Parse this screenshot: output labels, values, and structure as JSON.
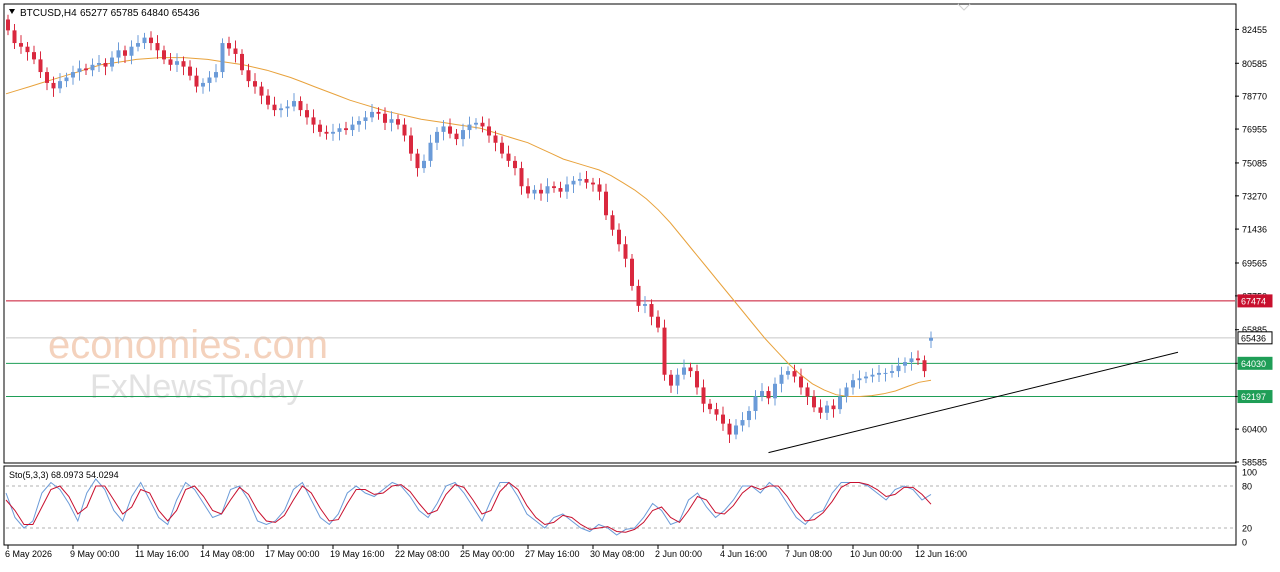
{
  "chart_data": {
    "type": "candlestick",
    "header": {
      "symbol": "BTCUSD,H4",
      "ohlc_text": "65277 65785 64840 65436",
      "dropdown_icon": "triangle-down-icon"
    },
    "price_axis": {
      "ylim": [
        58585,
        83800
      ],
      "ticks": [
        82455,
        80585,
        78770,
        76955,
        75085,
        73270,
        71436,
        69565,
        67750,
        65885,
        64030,
        62197,
        60400,
        58585
      ],
      "grid": false
    },
    "horizontal_levels": [
      {
        "value": 67474,
        "label": "67474",
        "color": "#c8102e"
      },
      {
        "value": 64030,
        "label": "64030",
        "color": "#1f9e57"
      },
      {
        "value": 62197,
        "label": "62197",
        "color": "#1f9e57"
      }
    ],
    "current_price": {
      "value": 65436,
      "label": "65436"
    },
    "trendline": {
      "from": [
        117,
        59100
      ],
      "to": [
        180,
        64640
      ],
      "color": "#000000"
    },
    "moving_average_color": "#e8a23c",
    "bull_color": "#6b9bd8",
    "bear_color": "#d9283e",
    "watermark": {
      "line1": "economies.com",
      "line2": "FxNewsToday"
    },
    "stochastic": {
      "label": "Sto(5,3,3) 68.0973 54.0294",
      "ylim": [
        0,
        100
      ],
      "ticks": [
        100,
        80,
        20,
        0
      ],
      "levels": [
        80,
        20
      ],
      "main_color": "#6b9bd8",
      "signal_color": "#c8102e"
    },
    "time_axis": {
      "labels": [
        "6 May 2026",
        "9 May 00:00",
        "11 May 16:00",
        "14 May 08:00",
        "17 May 00:00",
        "19 May 16:00",
        "22 May 08:00",
        "25 May 00:00",
        "27 May 16:00",
        "30 May 08:00",
        "2 Jun 00:00",
        "4 Jun 16:00",
        "7 Jun 08:00",
        "10 Jun 00:00",
        "12 Jun 16:00"
      ],
      "label_bar_index": [
        0,
        10,
        20,
        30,
        40,
        50,
        60,
        70,
        80,
        90,
        100,
        110,
        120,
        130,
        140
      ]
    },
    "closes": [
      82400,
      81700,
      81500,
      81200,
      80800,
      80100,
      79500,
      79200,
      79600,
      79800,
      80100,
      80300,
      80200,
      80500,
      80600,
      80400,
      80900,
      81300,
      81000,
      81500,
      81700,
      82000,
      81700,
      81300,
      80800,
      80500,
      80700,
      80400,
      79900,
      79300,
      79500,
      79800,
      80100,
      81700,
      81400,
      81100,
      80200,
      79600,
      79300,
      78800,
      78300,
      78000,
      78100,
      78200,
      78500,
      78000,
      77600,
      77200,
      76800,
      76700,
      76800,
      77000,
      76900,
      77200,
      77400,
      77600,
      77900,
      77800,
      77300,
      77500,
      77200,
      76600,
      75600,
      74800,
      75200,
      76200,
      76800,
      77100,
      76700,
      76400,
      76900,
      77200,
      77300,
      77100,
      76600,
      76200,
      75600,
      75200,
      74800,
      73800,
      73400,
      73600,
      73400,
      73800,
      73700,
      73500,
      73900,
      74100,
      74200,
      74000,
      73900,
      73500,
      72200,
      71400,
      70600,
      69800,
      68300,
      67200,
      67300,
      66600,
      66000,
      63400,
      62800,
      63400,
      63800,
      63600,
      62700,
      61800,
      61500,
      61200,
      60700,
      60100,
      60600,
      60900,
      61400,
      62200,
      62500,
      62100,
      62900,
      63400,
      63600,
      63300,
      62700,
      62200,
      61600,
      61300,
      61700,
      61500,
      62200,
      62700,
      63100,
      63200,
      63300,
      63400,
      63500,
      63500,
      63600,
      63900,
      64100,
      64300,
      64200,
      63600,
      65436
    ],
    "opens": [
      83000,
      82400,
      81700,
      81500,
      81200,
      80800,
      80100,
      79500,
      79200,
      79600,
      79800,
      80100,
      80300,
      80200,
      80500,
      80600,
      80400,
      80900,
      81300,
      81000,
      81500,
      81700,
      82000,
      81700,
      81300,
      80800,
      80500,
      80700,
      80400,
      79900,
      79300,
      79500,
      79800,
      80100,
      81700,
      81400,
      81100,
      80200,
      79600,
      79300,
      78800,
      78300,
      78000,
      78100,
      78200,
      78500,
      78000,
      77600,
      77200,
      76800,
      76700,
      76800,
      77000,
      76900,
      77200,
      77400,
      77600,
      77900,
      77800,
      77300,
      77500,
      77200,
      76600,
      75600,
      74800,
      75200,
      76200,
      76800,
      77100,
      76700,
      76400,
      76900,
      77200,
      77300,
      77100,
      76600,
      76200,
      75600,
      75200,
      74800,
      73800,
      73400,
      73600,
      73400,
      73800,
      73700,
      73500,
      73900,
      74100,
      74200,
      74000,
      73900,
      73500,
      72200,
      71400,
      70600,
      69800,
      68300,
      67200,
      67300,
      66600,
      66000,
      63400,
      62800,
      63400,
      63800,
      63600,
      62700,
      61800,
      61500,
      61200,
      60700,
      60100,
      60600,
      60900,
      61400,
      62200,
      62500,
      62100,
      62900,
      63400,
      63600,
      63300,
      62700,
      62200,
      61600,
      61300,
      61700,
      61500,
      62200,
      62700,
      63100,
      63200,
      63300,
      63400,
      63500,
      63500,
      63600,
      63900,
      64100,
      64300,
      64200,
      65277
    ],
    "ma": [
      78900,
      79100,
      79300,
      79500,
      79700,
      79900,
      80100,
      80300,
      80500,
      80600,
      80700,
      80800,
      80850,
      80900,
      80900,
      80900,
      80850,
      80800,
      80700,
      80600,
      80500,
      80350,
      80200,
      80000,
      79800,
      79550,
      79300,
      79050,
      78800,
      78550,
      78350,
      78150,
      77950,
      77800,
      77650,
      77500,
      77400,
      77300,
      77200,
      77100,
      77000,
      76800,
      76600,
      76400,
      76200,
      75900,
      75600,
      75300,
      75100,
      74900,
      74700,
      74400,
      74000,
      73600,
      73100,
      72500,
      71800,
      71000,
      70200,
      69400,
      68600,
      67800,
      67000,
      66200,
      65400,
      64700,
      64000,
      63400,
      62900,
      62550,
      62300,
      62200,
      62200,
      62250,
      62350,
      62500,
      62750,
      62980,
      63100
    ],
    "stoch_k": [
      70,
      35,
      20,
      30,
      70,
      85,
      75,
      55,
      30,
      70,
      90,
      75,
      45,
      30,
      65,
      85,
      60,
      35,
      25,
      60,
      85,
      75,
      55,
      35,
      40,
      75,
      80,
      60,
      30,
      25,
      30,
      45,
      75,
      85,
      60,
      35,
      25,
      40,
      70,
      80,
      70,
      65,
      75,
      85,
      80,
      65,
      45,
      35,
      55,
      80,
      85,
      70,
      50,
      30,
      60,
      85,
      85,
      65,
      40,
      30,
      20,
      35,
      40,
      30,
      20,
      15,
      25,
      20,
      10,
      18,
      20,
      35,
      55,
      45,
      25,
      30,
      60,
      70,
      50,
      35,
      45,
      60,
      80,
      80,
      70,
      85,
      75,
      55,
      35,
      25,
      40,
      45,
      70,
      85,
      85,
      85,
      80,
      70,
      60,
      75,
      80,
      75,
      60,
      68
    ],
    "stoch_d": [
      60,
      45,
      25,
      25,
      50,
      75,
      80,
      65,
      40,
      50,
      80,
      80,
      60,
      40,
      50,
      75,
      70,
      45,
      30,
      45,
      75,
      80,
      65,
      45,
      40,
      60,
      78,
      68,
      45,
      30,
      28,
      38,
      60,
      80,
      70,
      48,
      30,
      32,
      55,
      75,
      75,
      68,
      70,
      80,
      82,
      72,
      55,
      40,
      45,
      68,
      82,
      78,
      60,
      40,
      45,
      72,
      85,
      75,
      52,
      35,
      25,
      28,
      38,
      35,
      25,
      18,
      20,
      22,
      15,
      14,
      18,
      28,
      45,
      50,
      35,
      28,
      45,
      65,
      60,
      42,
      40,
      52,
      70,
      80,
      75,
      80,
      80,
      65,
      45,
      30,
      32,
      42,
      58,
      78,
      85,
      85,
      82,
      75,
      65,
      68,
      78,
      78,
      68,
      54
    ]
  }
}
